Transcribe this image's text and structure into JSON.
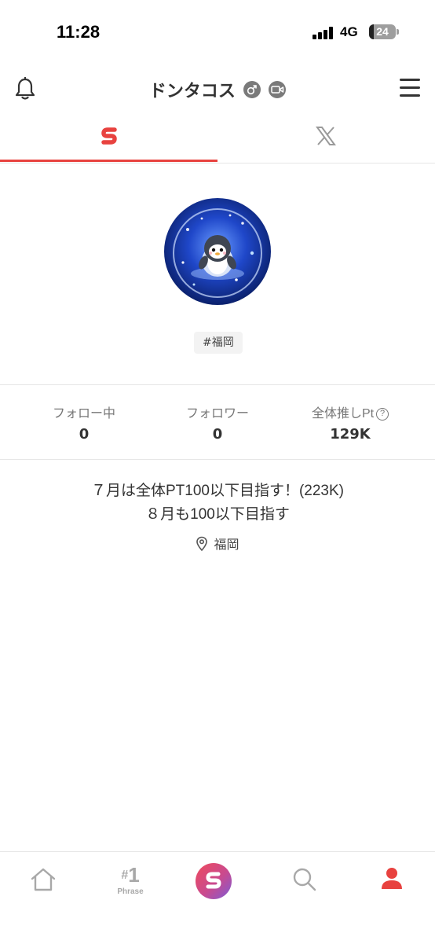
{
  "status_bar": {
    "time": "11:28",
    "network": "4G",
    "battery": "24"
  },
  "header": {
    "username": "ドンタコス"
  },
  "tabs": [
    {
      "name": "app-tab",
      "icon": "app-logo-icon",
      "active": true
    },
    {
      "name": "x-tab",
      "icon": "x-logo-icon",
      "active": false
    }
  ],
  "profile": {
    "tag": "#福岡",
    "stats": [
      {
        "label": "フォロー中",
        "value": "0"
      },
      {
        "label": "フォロワー",
        "value": "0"
      },
      {
        "label": "全体推しPt",
        "value": "129K"
      }
    ],
    "bio_lines": [
      "７月は全体PT100以下目指す！(223K)",
      "８月も100以下目指す"
    ],
    "location": "福岡"
  },
  "bottom_nav": {
    "phrase_number": "1",
    "phrase_label": "Phrase"
  },
  "colors": {
    "accent": "#e8423f",
    "tab_inactive": "#9a9a9a",
    "nav_inactive": "#a8a8a8"
  }
}
